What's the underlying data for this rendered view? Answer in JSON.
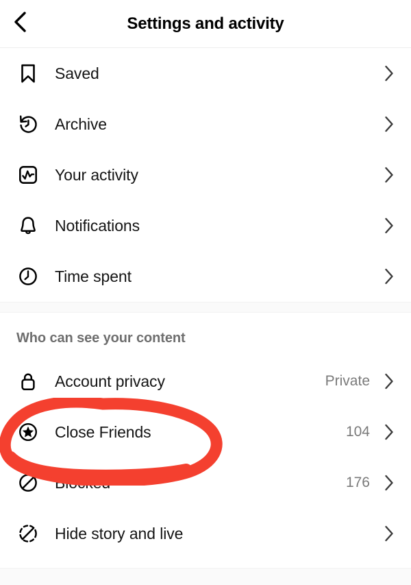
{
  "header": {
    "title": "Settings and activity",
    "back_icon": "chevron-left-icon"
  },
  "colors": {
    "annotation_red": "#F4402F",
    "label_text": "#141414",
    "value_text": "#7A7A7A",
    "section_text": "#6E6E6E",
    "band": "#FAFAFA",
    "background": "#FFFFFF"
  },
  "sections": [
    {
      "title": "",
      "items": [
        {
          "label": "Saved",
          "icon": "bookmark-icon",
          "value": "",
          "chevron": "chevron-right-icon"
        },
        {
          "label": "Archive",
          "icon": "archive-clock-icon",
          "value": "",
          "chevron": "chevron-right-icon"
        },
        {
          "label": "Your activity",
          "icon": "activity-chart-icon",
          "value": "",
          "chevron": "chevron-right-icon"
        },
        {
          "label": "Notifications",
          "icon": "bell-icon",
          "value": "",
          "chevron": "chevron-right-icon"
        },
        {
          "label": "Time spent",
          "icon": "clock-icon",
          "value": "",
          "chevron": "chevron-right-icon"
        }
      ]
    },
    {
      "title": "Who can see your content",
      "items": [
        {
          "label": "Account privacy",
          "icon": "lock-icon",
          "value": "Private",
          "chevron": "chevron-right-icon"
        },
        {
          "label": "Close Friends",
          "icon": "star-circle-icon",
          "value": "104",
          "chevron": "chevron-right-icon"
        },
        {
          "label": "Blocked",
          "icon": "block-icon",
          "value": "176",
          "chevron": "chevron-right-icon"
        },
        {
          "label": "Hide story and live",
          "icon": "hide-story-icon",
          "value": "",
          "chevron": "chevron-right-icon"
        }
      ]
    }
  ],
  "annotation": {
    "type": "hand-drawn-ellipse",
    "target_label": "Close Friends",
    "color": "#F4402F"
  }
}
